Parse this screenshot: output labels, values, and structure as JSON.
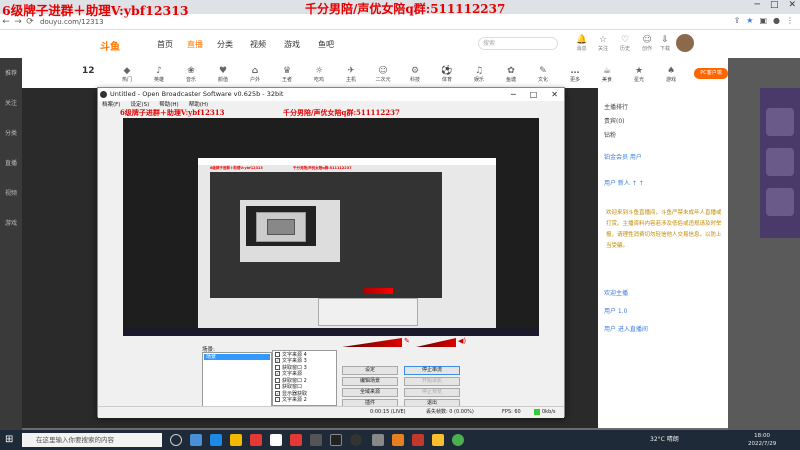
{
  "overlay": {
    "left_text": "6级牌子进群＋助理V:ybf12313",
    "right_text": "千分男陪/声优女陪q群:511112237"
  },
  "browser": {
    "url": "douyu.com/12313"
  },
  "site": {
    "logo": "斗鱼",
    "nav": [
      "首页",
      "直播",
      "分类",
      "视频",
      "游戏",
      "鱼吧"
    ],
    "search_placeholder": "搜索",
    "header_icons": [
      {
        "icon": "bell-icon",
        "label": "消息"
      },
      {
        "icon": "star-icon",
        "label": "关注"
      },
      {
        "icon": "heart-icon",
        "label": "历史"
      },
      {
        "icon": "user-icon",
        "label": "创作"
      },
      {
        "icon": "download-icon",
        "label": "下载"
      }
    ],
    "left_rail": [
      "推荐",
      "关注",
      "分类",
      "直播",
      "视频",
      "游戏"
    ],
    "categories_count": "12",
    "categories": [
      "热门",
      "英雄",
      "音乐",
      "颜值",
      "户外",
      "王者",
      "吃鸡",
      "主机",
      "二次元",
      "科技",
      "体育",
      "娱乐",
      "鱼塘",
      "文化",
      "更多",
      "美食",
      "星光",
      "游戏"
    ],
    "pc_button": "PC客户端",
    "right_panel": {
      "rows": [
        "主播排行",
        "贵宾(0)",
        "钻粉"
      ],
      "notice": "欢迎来到斗鱼直播间，斗鱼严禁未成年人直播或打赏。主播资料内容若涉及低俗或违规请及时举报，请理性消费切勿轻信他人交易信息，以防上当受骗。",
      "user_rows": [
        "铂金会员  用户",
        "用户  新人  ↑ ↑",
        "欢迎主播",
        "用户  1.0 ",
        "用户  进入直播间"
      ]
    }
  },
  "obs": {
    "title": "Untitled - Open Broadcaster Software v0.625b - 32bit",
    "menu": [
      "档案(F)",
      "设定(S)",
      "帮助(H)",
      "帮助(H)"
    ],
    "scenes_label": "场景:",
    "scene_selected": "场景",
    "sources": [
      {
        "label": "文字来源 4",
        "checked": false
      },
      {
        "label": "文字来源 3",
        "checked": true
      },
      {
        "label": "获取窗口 3",
        "checked": false
      },
      {
        "label": "文字来源",
        "checked": true
      },
      {
        "label": "获取窗口 2",
        "checked": false
      },
      {
        "label": "获取窗口",
        "checked": false
      },
      {
        "label": "显示器获取",
        "checked": true
      },
      {
        "label": "文字来源 2",
        "checked": false
      }
    ],
    "buttons": {
      "settings": "设定",
      "stop_stream": "停止串流",
      "edit_scene": "编辑场景",
      "start_record": "开始录影",
      "global_sources": "全域来源",
      "preview": "停止预览",
      "plugins": "插件",
      "exit": "退出"
    },
    "status": {
      "time": "0:00:15 (LIVE)",
      "dropped": "丢失帧数: 0 (0.00%)",
      "fps": "FPS: 60",
      "bitrate": "0kb/s"
    }
  },
  "taskbar": {
    "search_placeholder": "在这里输入你要搜索的内容",
    "weather": "32°C 晴朗",
    "time": "18:00",
    "date": "2022/7/29"
  }
}
